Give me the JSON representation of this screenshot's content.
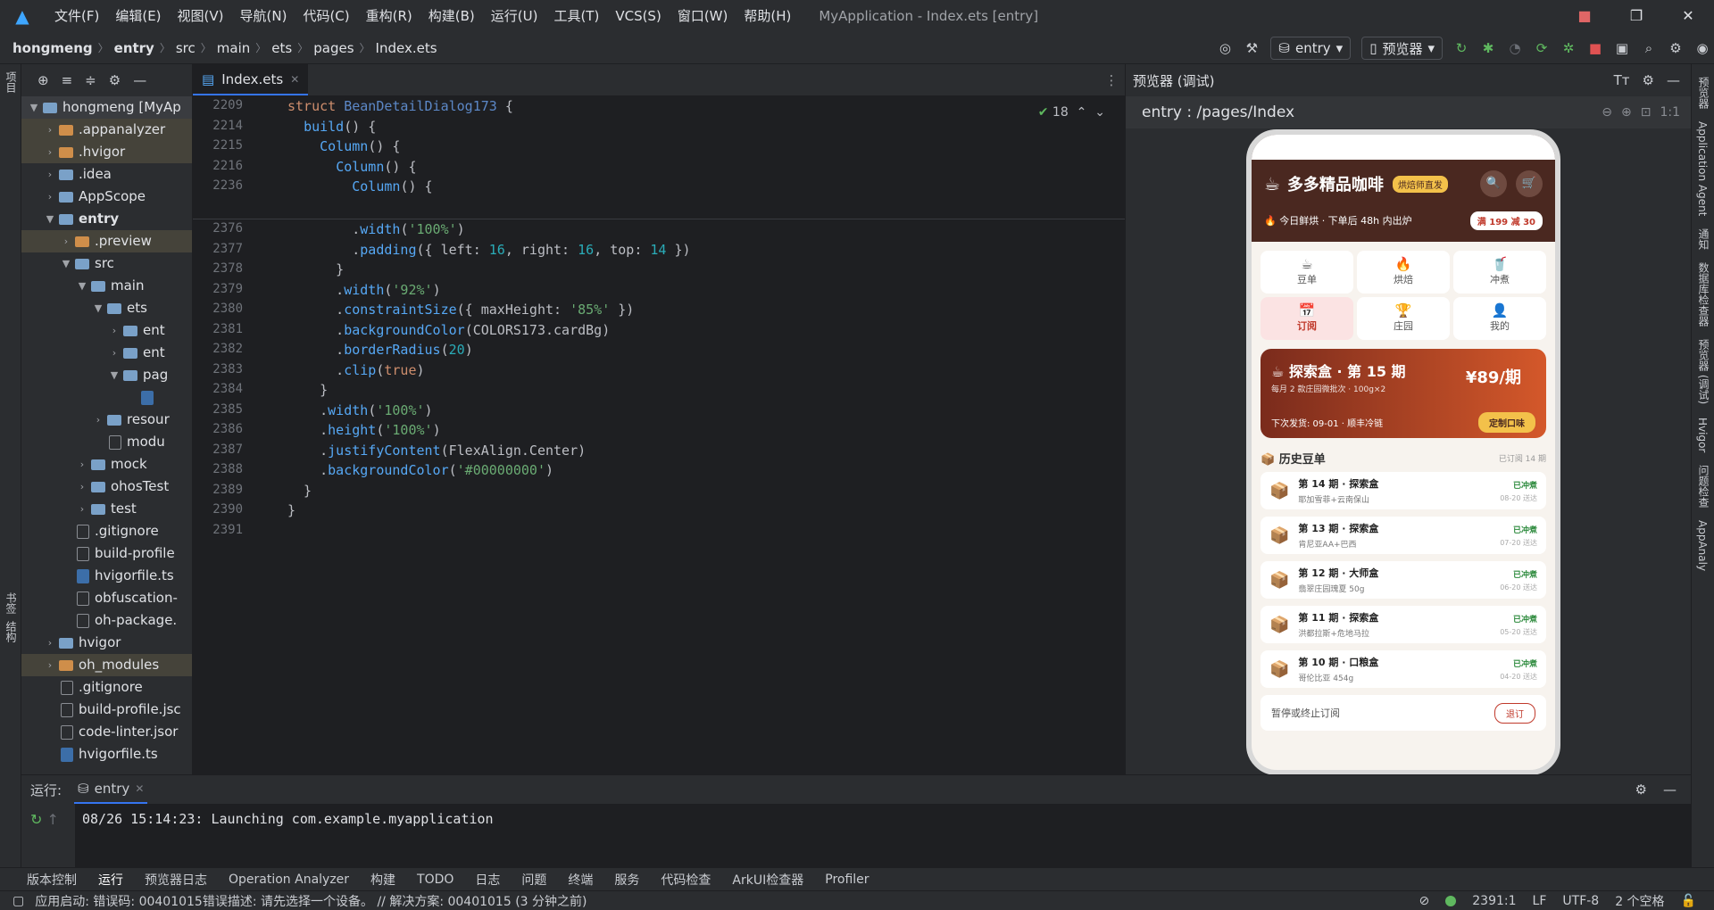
{
  "menu": [
    "文件(F)",
    "编辑(E)",
    "视图(V)",
    "导航(N)",
    "代码(C)",
    "重构(R)",
    "构建(B)",
    "运行(U)",
    "工具(T)",
    "VCS(S)",
    "窗口(W)",
    "帮助(H)"
  ],
  "window_title": "MyApplication - Index.ets [entry]",
  "breadcrumb": [
    "hongmeng",
    "entry",
    "src",
    "main",
    "ets",
    "pages",
    "Index.ets"
  ],
  "nav": {
    "module": "entry",
    "device": "预览器"
  },
  "left_strip": {
    "project": "项目",
    "bookmarks": "书签",
    "structure": "结构"
  },
  "project_tree": [
    {
      "indent": 0,
      "arrow": "▼",
      "type": "folder",
      "label": "hongmeng [MyAp",
      "cls": "sel"
    },
    {
      "indent": 1,
      "arrow": "›",
      "type": "folder-o",
      "label": ".appanalyzer",
      "cls": "hl"
    },
    {
      "indent": 1,
      "arrow": "›",
      "type": "folder-o",
      "label": ".hvigor",
      "cls": "hl"
    },
    {
      "indent": 1,
      "arrow": "›",
      "type": "folder",
      "label": ".idea",
      "cls": ""
    },
    {
      "indent": 1,
      "arrow": "›",
      "type": "folder",
      "label": "AppScope",
      "cls": ""
    },
    {
      "indent": 1,
      "arrow": "▼",
      "type": "folder",
      "label": "entry",
      "cls": "",
      "bold": true
    },
    {
      "indent": 2,
      "arrow": "›",
      "type": "folder-o",
      "label": ".preview",
      "cls": "hl"
    },
    {
      "indent": 2,
      "arrow": "▼",
      "type": "folder",
      "label": "src",
      "cls": ""
    },
    {
      "indent": 3,
      "arrow": "▼",
      "type": "folder",
      "label": "main",
      "cls": ""
    },
    {
      "indent": 4,
      "arrow": "▼",
      "type": "folder",
      "label": "ets",
      "cls": ""
    },
    {
      "indent": 5,
      "arrow": "›",
      "type": "folder",
      "label": "ent",
      "cls": ""
    },
    {
      "indent": 5,
      "arrow": "›",
      "type": "folder",
      "label": "ent",
      "cls": ""
    },
    {
      "indent": 5,
      "arrow": "▼",
      "type": "folder",
      "label": "pag",
      "cls": ""
    },
    {
      "indent": 6,
      "arrow": "",
      "type": "file-ts",
      "label": "",
      "cls": ""
    },
    {
      "indent": 4,
      "arrow": "›",
      "type": "folder",
      "label": "resour",
      "cls": ""
    },
    {
      "indent": 4,
      "arrow": "",
      "type": "file",
      "label": "modu",
      "cls": ""
    },
    {
      "indent": 3,
      "arrow": "›",
      "type": "folder",
      "label": "mock",
      "cls": ""
    },
    {
      "indent": 3,
      "arrow": "›",
      "type": "folder",
      "label": "ohosTest",
      "cls": ""
    },
    {
      "indent": 3,
      "arrow": "›",
      "type": "folder",
      "label": "test",
      "cls": ""
    },
    {
      "indent": 2,
      "arrow": "",
      "type": "file",
      "label": ".gitignore",
      "cls": ""
    },
    {
      "indent": 2,
      "arrow": "",
      "type": "file",
      "label": "build-profile",
      "cls": ""
    },
    {
      "indent": 2,
      "arrow": "",
      "type": "file-ts",
      "label": "hvigorfile.ts",
      "cls": ""
    },
    {
      "indent": 2,
      "arrow": "",
      "type": "file",
      "label": "obfuscation-",
      "cls": ""
    },
    {
      "indent": 2,
      "arrow": "",
      "type": "file",
      "label": "oh-package.",
      "cls": ""
    },
    {
      "indent": 1,
      "arrow": "›",
      "type": "folder",
      "label": "hvigor",
      "cls": ""
    },
    {
      "indent": 1,
      "arrow": "›",
      "type": "folder-o",
      "label": "oh_modules",
      "cls": "hl"
    },
    {
      "indent": 1,
      "arrow": "",
      "type": "file",
      "label": ".gitignore",
      "cls": ""
    },
    {
      "indent": 1,
      "arrow": "",
      "type": "file",
      "label": "build-profile.jsc",
      "cls": ""
    },
    {
      "indent": 1,
      "arrow": "",
      "type": "file",
      "label": "code-linter.jsor",
      "cls": ""
    },
    {
      "indent": 1,
      "arrow": "",
      "type": "file-ts",
      "label": "hvigorfile.ts",
      "cls": ""
    }
  ],
  "editor": {
    "tab": "Index.ets",
    "inspection_count": "18",
    "sticky_lines": [
      {
        "n": "2209",
        "html": "<span class='kw'>struct</span> <span class='ty'>BeanDetailDialog173</span> {"
      },
      {
        "n": "2214",
        "html": "  <span class='fn'>build</span>() {"
      },
      {
        "n": "2215",
        "html": "    <span class='fn'>Column</span>() {"
      },
      {
        "n": "2216",
        "html": "      <span class='fn'>Column</span>() {"
      },
      {
        "n": "2236",
        "html": "        <span class='fn'>Column</span>() {"
      }
    ],
    "lines": [
      {
        "n": "2376",
        "html": "        .<span class='fn'>width</span>(<span class='str'>'100%'</span>)"
      },
      {
        "n": "2377",
        "html": "        .<span class='fn'>padding</span>({ left: <span class='num'>16</span>, right: <span class='num'>16</span>, top: <span class='num'>14</span> })"
      },
      {
        "n": "2378",
        "html": "      }"
      },
      {
        "n": "2379",
        "html": "      .<span class='fn'>width</span>(<span class='str'>'92%'</span>)"
      },
      {
        "n": "2380",
        "html": "      .<span class='fn'>constraintSize</span>({ maxHeight: <span class='str'>'85%'</span> })"
      },
      {
        "n": "2381",
        "html": "      .<span class='fn'>backgroundColor</span>(COLORS173.cardBg)"
      },
      {
        "n": "2382",
        "html": "      .<span class='fn'>borderRadius</span>(<span class='num'>20</span>)"
      },
      {
        "n": "2383",
        "html": "      .<span class='fn'>clip</span>(<span class='kw'>true</span>)"
      },
      {
        "n": "2384",
        "html": "    }"
      },
      {
        "n": "2385",
        "html": "    .<span class='fn'>width</span>(<span class='str'>'100%'</span>)"
      },
      {
        "n": "2386",
        "html": "    .<span class='fn'>height</span>(<span class='str'>'100%'</span>)"
      },
      {
        "n": "2387",
        "html": "    .<span class='fn'>justifyContent</span>(FlexAlign.Center)"
      },
      {
        "n": "2388",
        "html": "    .<span class='fn'>backgroundColor</span>(<span class='str'>'#00000000'</span>)"
      },
      {
        "n": "2389",
        "html": "  }"
      },
      {
        "n": "2390",
        "html": "}"
      },
      {
        "n": "2391",
        "html": ""
      }
    ]
  },
  "preview": {
    "title": "预览器 (调试)",
    "path": "entry : /pages/Index",
    "zoom": "1:1",
    "app": {
      "name": "多多精品咖啡",
      "badge": "烘焙师直发",
      "fresh": "🔥 今日鲜烘 · 下单后 48h 内出炉",
      "coupon": "满 199 减 30",
      "grid": [
        {
          "icon": "☕",
          "label": "豆单",
          "active": false
        },
        {
          "icon": "🔥",
          "label": "烘焙",
          "active": false
        },
        {
          "icon": "🥤",
          "label": "冲煮",
          "active": false
        },
        {
          "icon": "📅",
          "label": "订阅",
          "active": true
        },
        {
          "icon": "🏆",
          "label": "庄园",
          "active": false
        },
        {
          "icon": "👤",
          "label": "我的",
          "active": false
        }
      ],
      "sub": {
        "title": "☕ 探索盒 · 第 15 期",
        "price": "¥89/期",
        "desc": "每月 2 款庄园微批次 · 100g×2",
        "next": "下次发货: 09-01 · 顺丰冷链",
        "button": "定制口味"
      },
      "history_title": "📦 历史豆单",
      "history_count": "已订阅 14 期",
      "history": [
        {
          "title": "第 14 期 · 探索盒",
          "sub": "耶加雪菲+云南保山",
          "status": "已冲煮",
          "date": "08-20 送达"
        },
        {
          "title": "第 13 期 · 探索盒",
          "sub": "肯尼亚AA+巴西",
          "status": "已冲煮",
          "date": "07-20 送达"
        },
        {
          "title": "第 12 期 · 大师盒",
          "sub": "翡翠庄园瑰夏 50g",
          "status": "已冲煮",
          "date": "06-20 送达"
        },
        {
          "title": "第 11 期 · 探索盒",
          "sub": "洪都拉斯+危地马拉",
          "status": "已冲煮",
          "date": "05-20 送达"
        },
        {
          "title": "第 10 期 · 口粮盒",
          "sub": "哥伦比亚 454g",
          "status": "已冲煮",
          "date": "04-20 送达"
        }
      ],
      "footer": "暂停或终止订阅",
      "footer_btn": "退订"
    }
  },
  "right_strip": [
    "预览器",
    "Application Agent",
    "通知",
    "数据库检查器",
    "预览器 (调试)",
    "Hvigor",
    "问题检查",
    "AppAnaly"
  ],
  "run": {
    "label": "运行:",
    "tab": "entry",
    "log": "08/26 15:14:23: Launching com.example.myapplication"
  },
  "toolbar": [
    "版本控制",
    "运行",
    "预览器日志",
    "Operation Analyzer",
    "构建",
    "TODO",
    "日志",
    "问题",
    "终端",
    "服务",
    "代码检查",
    "ArkUI检查器",
    "Profiler"
  ],
  "status": {
    "message": "应用启动: 错误码: 00401015错误描述: 请先选择一个设备。 // 解决方案: 00401015 (3 分钟之前)",
    "position": "2391:1",
    "line_sep": "LF",
    "encoding": "UTF-8",
    "indent": "2 个空格"
  }
}
